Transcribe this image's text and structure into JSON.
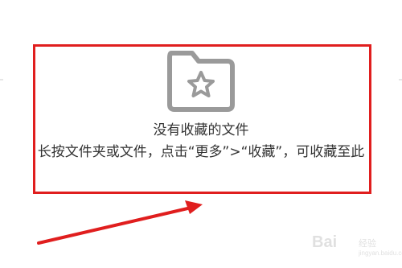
{
  "empty_state": {
    "icon": "folder-star-icon",
    "title": "没有收藏的文件",
    "hint": "长按文件夹或文件，点击“更多”>“收藏”，可收藏至此"
  },
  "annotation": {
    "highlight_color": "#e01e1e",
    "arrow_color": "#e01e1e"
  },
  "watermark": {
    "brand": "Bai",
    "brand_cn": "经验",
    "domain": "jingyan.baidu.com"
  },
  "colors": {
    "icon_gray": "#9a9a9a",
    "text": "#333333",
    "background": "#ffffff"
  }
}
